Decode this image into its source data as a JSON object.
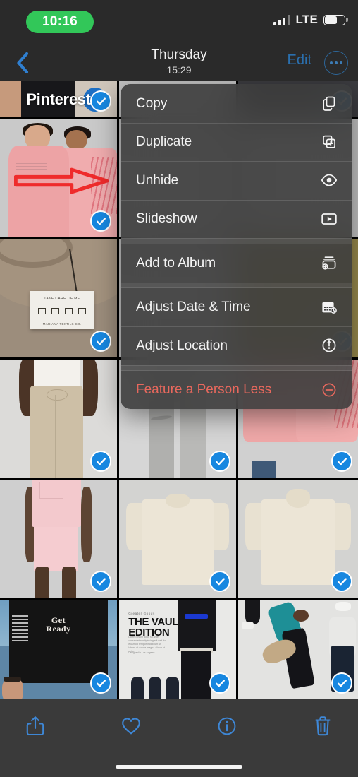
{
  "status_bar": {
    "recording_time": "10:16",
    "carrier_network": "LTE",
    "signal_bars_filled": 3,
    "signal_bars_total": 4,
    "battery_percent": 70
  },
  "nav_bar": {
    "back_icon": "chevron-left-icon",
    "title": "Thursday",
    "subtitle": "15:29",
    "edit_label": "Edit",
    "more_icon": "ellipsis-circle-icon"
  },
  "context_menu": {
    "groups": [
      {
        "items": [
          {
            "label": "Copy",
            "icon": "copy-icon",
            "style": "default"
          },
          {
            "label": "Duplicate",
            "icon": "duplicate-icon",
            "style": "default"
          },
          {
            "label": "Unhide",
            "icon": "eye-icon",
            "style": "default"
          },
          {
            "label": "Slideshow",
            "icon": "play-rectangle-icon",
            "style": "default"
          }
        ]
      },
      {
        "items": [
          {
            "label": "Add to Album",
            "icon": "add-to-album-icon",
            "style": "default"
          }
        ]
      },
      {
        "items": [
          {
            "label": "Adjust Date & Time",
            "icon": "calendar-clock-icon",
            "style": "default"
          },
          {
            "label": "Adjust Location",
            "icon": "location-circle-icon",
            "style": "default"
          }
        ]
      },
      {
        "items": [
          {
            "label": "Feature a Person Less",
            "icon": "minus-circle-icon",
            "style": "destructive"
          }
        ]
      }
    ]
  },
  "grid": {
    "columns": 3,
    "selection_icon": "checkmark-circle-icon",
    "photos": [
      {
        "id": "p1",
        "row": 0,
        "col": 0,
        "kind": "banner",
        "overlay_text": "Pinterest",
        "selected": true
      },
      {
        "id": "p2",
        "row": 0,
        "col": 1,
        "kind": "plain-gray",
        "selected": true
      },
      {
        "id": "p3",
        "row": 0,
        "col": 2,
        "kind": "plain-dark",
        "selected": true
      },
      {
        "id": "p4",
        "row": 1,
        "col": 0,
        "kind": "couple-pink",
        "annotation": "red-arrow",
        "selected": true
      },
      {
        "id": "p5",
        "row": 1,
        "col": 1,
        "kind": "plain-gray",
        "selected": true
      },
      {
        "id": "p6",
        "row": 1,
        "col": 2,
        "kind": "plain-gray",
        "selected": true
      },
      {
        "id": "p7",
        "row": 2,
        "col": 0,
        "kind": "care-tag",
        "tag_line_1": "TAKE CARE OF ME",
        "tag_line_2": "MARIANA TEXTILS CO.",
        "selected": true
      },
      {
        "id": "p8",
        "row": 2,
        "col": 1,
        "kind": "plain-gray",
        "selected": true
      },
      {
        "id": "p9",
        "row": 2,
        "col": 2,
        "kind": "plain-olive",
        "selected": true
      },
      {
        "id": "p10",
        "row": 3,
        "col": 0,
        "kind": "beige-pants",
        "selected": true
      },
      {
        "id": "p11",
        "row": 3,
        "col": 1,
        "kind": "gray-sweats",
        "selected": true
      },
      {
        "id": "p12",
        "row": 3,
        "col": 2,
        "kind": "pink-pair",
        "selected": true
      },
      {
        "id": "p13",
        "row": 4,
        "col": 0,
        "kind": "tattoo-shorts",
        "selected": true
      },
      {
        "id": "p14",
        "row": 4,
        "col": 1,
        "kind": "cream-tee",
        "selected": true
      },
      {
        "id": "p15",
        "row": 4,
        "col": 2,
        "kind": "cream-tee-high",
        "selected": true
      },
      {
        "id": "p16",
        "row": 5,
        "col": 0,
        "kind": "black-tee",
        "overlay_text": "Get\nReady",
        "selected": true
      },
      {
        "id": "p17",
        "row": 5,
        "col": 1,
        "kind": "vault-poster",
        "poster_kicker": "Greater Goods",
        "poster_title": "THE VAULT\nEDITION",
        "selected": true
      },
      {
        "id": "p18",
        "row": 5,
        "col": 2,
        "kind": "skaters",
        "selected": true
      }
    ]
  },
  "toolbar": {
    "items": [
      {
        "label": "Share",
        "icon": "share-icon"
      },
      {
        "label": "Favorite",
        "icon": "heart-icon"
      },
      {
        "label": "Info",
        "icon": "info-circle-icon"
      },
      {
        "label": "Delete",
        "icon": "trash-icon"
      }
    ]
  },
  "colors": {
    "accent_blue": "#3e87d6",
    "selection_blue": "#1787e0",
    "destructive_red": "#e8685d",
    "recording_green": "#32c759",
    "menu_background": "#3c3c3c",
    "toolbar_background": "#3a3a3a"
  }
}
